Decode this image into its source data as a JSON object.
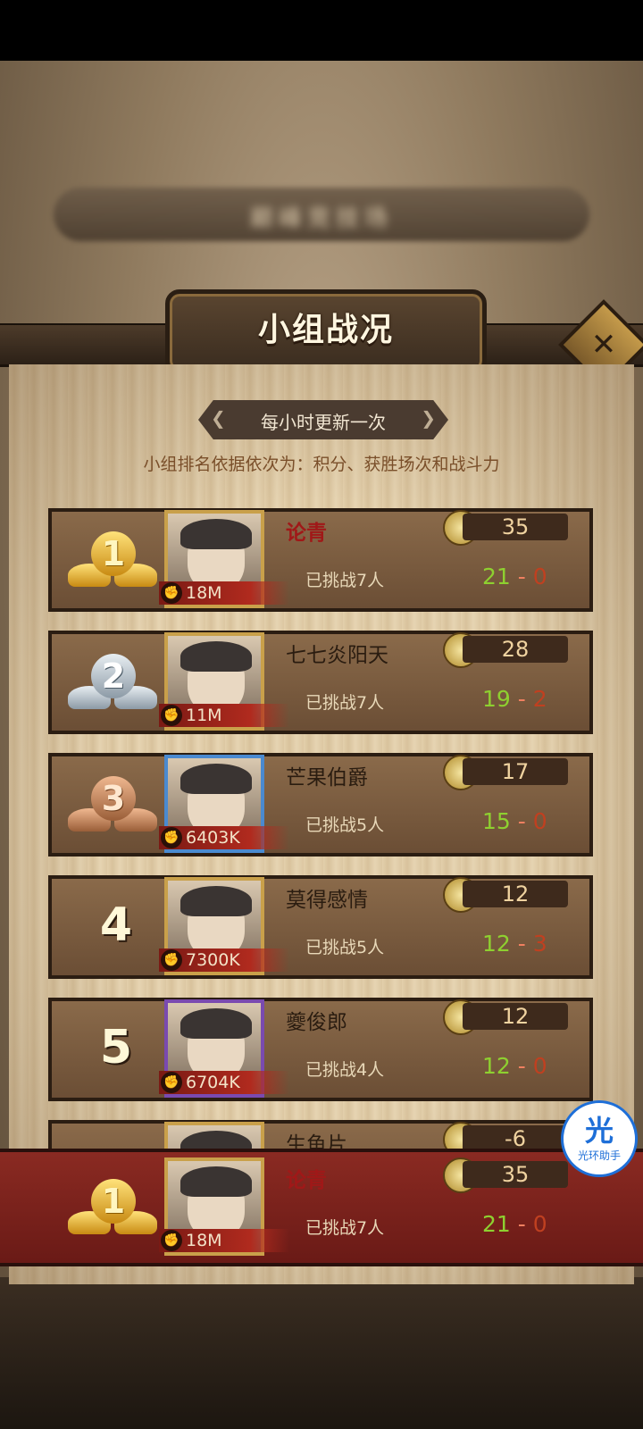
{
  "title": "小组战况",
  "update_note": "每小时更新一次",
  "ranking_rule": "小组排名依据依次为：积分、获胜场次和战斗力",
  "close_icon": "close-icon",
  "background_banner": "巅峰竞技场",
  "rows": [
    {
      "rank": "1",
      "medal": "gold",
      "name": "论青",
      "is_self": true,
      "power": "18M",
      "score": "35",
      "challenged": "已挑战7人",
      "wins": "21",
      "sep": "-",
      "losses": "0"
    },
    {
      "rank": "2",
      "medal": "silver",
      "name": "七七炎阳天",
      "is_self": false,
      "power": "11M",
      "score": "28",
      "challenged": "已挑战7人",
      "wins": "19",
      "sep": "-",
      "losses": "2"
    },
    {
      "rank": "3",
      "medal": "bronze",
      "name": "芒果伯爵",
      "is_self": false,
      "power": "6403K",
      "score": "17",
      "challenged": "已挑战5人",
      "wins": "15",
      "sep": "-",
      "losses": "0"
    },
    {
      "rank": "4",
      "medal": "",
      "name": "莫得感情",
      "is_self": false,
      "power": "7300K",
      "score": "12",
      "challenged": "已挑战5人",
      "wins": "12",
      "sep": "-",
      "losses": "3"
    },
    {
      "rank": "5",
      "medal": "",
      "name": "夔俊郎",
      "is_self": false,
      "power": "6704K",
      "score": "12",
      "challenged": "已挑战4人",
      "wins": "12",
      "sep": "-",
      "losses": "0"
    },
    {
      "rank": "6",
      "medal": "",
      "name": "生鱼片",
      "is_self": false,
      "power": "",
      "score": "-6",
      "challenged": "",
      "wins": "",
      "sep": "",
      "losses": ""
    }
  ],
  "self_row": {
    "rank": "1",
    "medal": "gold",
    "name": "论青",
    "power": "18M",
    "score": "35",
    "challenged": "已挑战7人",
    "wins": "21",
    "sep": "-",
    "losses": "0"
  },
  "floating_badge": {
    "glyph": "光",
    "caption": "光环助手"
  },
  "colors": {
    "accent_red": "#a01818",
    "win_green": "#8ed030",
    "loss_red": "#c04020",
    "gold": "#e2b23a"
  }
}
